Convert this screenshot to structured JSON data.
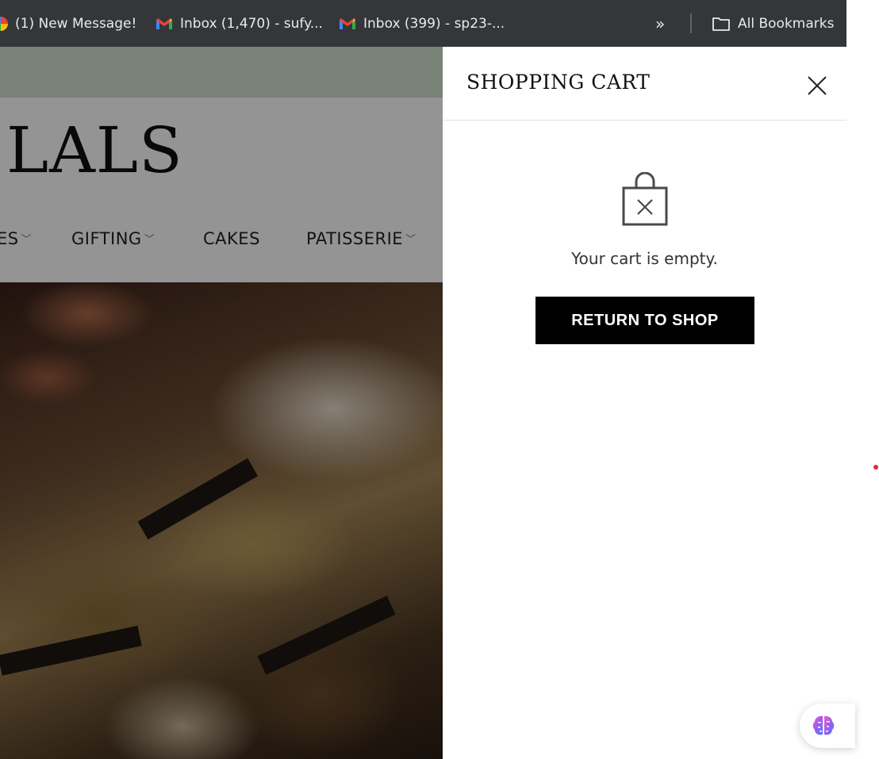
{
  "bookmarks": {
    "item1": "(1) New Message!",
    "item2": "Inbox (1,470) - sufy...",
    "item3": "Inbox (399) - sp23-...",
    "more": "»",
    "all": "All Bookmarks"
  },
  "site": {
    "logo": "LALS",
    "nav": [
      "ES",
      "GIFTING",
      "CAKES",
      "PATISSERIE"
    ]
  },
  "cart": {
    "title": "SHOPPING CART",
    "empty_text": "Your cart is empty.",
    "return_label": "RETURN TO SHOP"
  },
  "icons": {
    "close": "close-icon",
    "empty_bag": "shopping-bag-icon",
    "ai": "brain-icon",
    "folder": "folder-icon",
    "gmail": "gmail-icon"
  },
  "colors": {
    "bookmarks_bg": "#35363a",
    "button_bg": "#000000",
    "gmail_red": "#ea4335"
  }
}
